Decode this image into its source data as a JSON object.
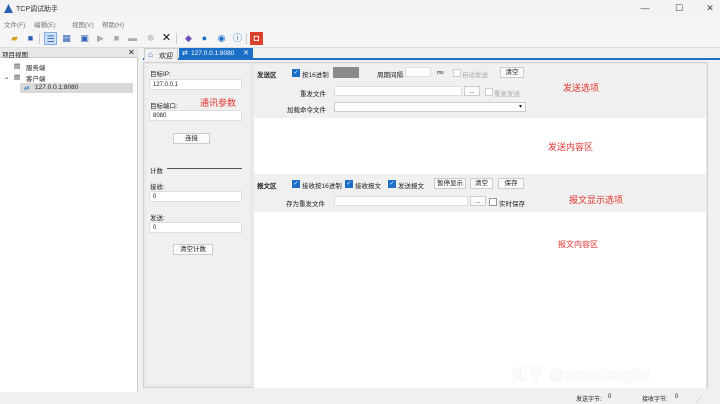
{
  "window": {
    "title": "TCP调试助手",
    "minimize": "—",
    "maximize": "☐",
    "close": "✕"
  },
  "menu": [
    "文件(F)",
    "编辑(E)",
    "视图(V)",
    "帮助(H)"
  ],
  "toolbar_icons": [
    "folder-open-icon",
    "save-icon",
    "list-icon",
    "network-icon",
    "play-icon",
    "stop-icon",
    "link-icon",
    "settings-icon",
    "delete-icon",
    "gem-icon",
    "globe-icon",
    "globe2-icon",
    "info-icon",
    "exit-icon"
  ],
  "left_panel": {
    "title": "项目视图",
    "close": "✕",
    "tree": {
      "server": "服务端",
      "client": "客户端",
      "connection": "127.0.0.1:8080"
    }
  },
  "tabs": [
    {
      "label": "欢迎"
    },
    {
      "label": "127.0.0.1:8080"
    }
  ],
  "comm": {
    "target_ip_label": "目标IP:",
    "target_ip": "127.0.0.1",
    "target_port_label": "目标端口:",
    "target_port": "8080",
    "connect_button": "连接",
    "count_label": "计数",
    "recv_label": "接收:",
    "recv_value": "0",
    "send_label": "发送:",
    "send_value": "0",
    "clear_count_button": "清空计数",
    "annotation": "通讯参数"
  },
  "send": {
    "area_label": "发送区",
    "hex_label": "按16进制",
    "period_label": "周期间隔",
    "period_unit": "ms",
    "auto_send_label": "自动发送",
    "clear_button": "清空",
    "resend_file_label": "重发文件",
    "browse_button": "...",
    "resend_label": "重复发送",
    "load_cmd_label": "加载命令文件",
    "options_annotation": "发送选项",
    "content_annotation": "发送内容区"
  },
  "recv": {
    "area_label": "报文区",
    "recv_hex_label": "接收按16进制",
    "recv_msg_label": "接收报文",
    "send_msg_label": "发送报文",
    "pause_button": "暂停显示",
    "clear_button": "清空",
    "save_button": "保存",
    "save_as_label": "存为重发文件",
    "browse_button": "...",
    "realtime_save_label": "实时保存",
    "options_annotation": "报文显示选项",
    "content_annotation": "报文内容区"
  },
  "status": {
    "send_bytes_label": "发送字节:",
    "send_bytes": "0",
    "recv_bytes_label": "接收字节:",
    "recv_bytes": "0"
  },
  "watermark": "知乎 @xiaoxiangfei",
  "colors": {
    "accent": "#1c6fc7",
    "annotation": "#e0322c"
  }
}
